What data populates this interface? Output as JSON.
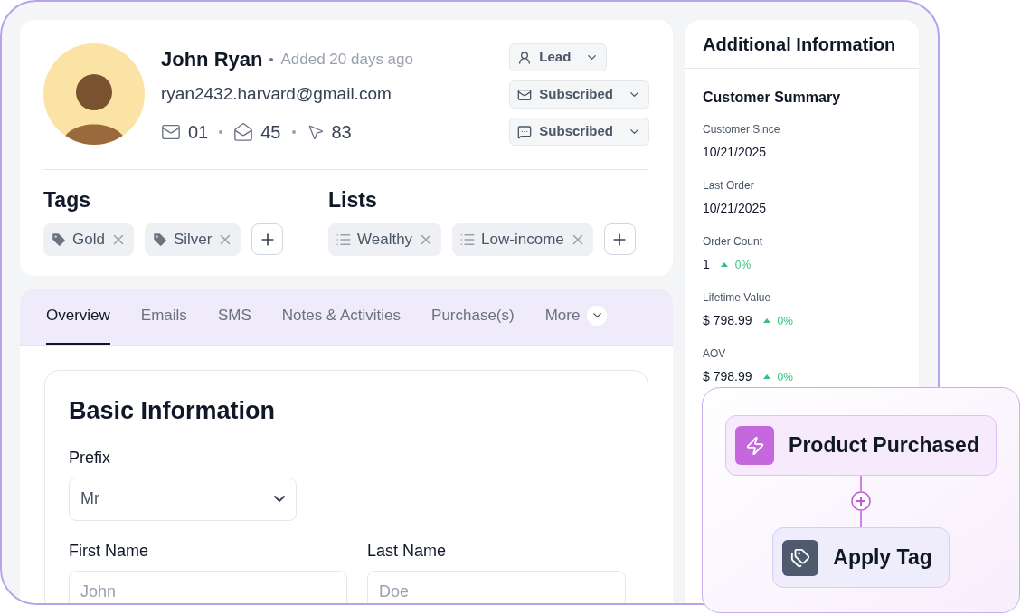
{
  "profile": {
    "name": "John Ryan",
    "added": "Added 20 days ago",
    "email": "ryan2432.harvard@gmail.com",
    "stats": [
      {
        "kind": "sent",
        "value": "01"
      },
      {
        "kind": "opened",
        "value": "45"
      },
      {
        "kind": "clicked",
        "value": "83"
      }
    ],
    "statuses": [
      {
        "kind": "contact",
        "label": "Lead"
      },
      {
        "kind": "email",
        "label": "Subscribed"
      },
      {
        "kind": "sms",
        "label": "Subscribed"
      }
    ]
  },
  "tags": {
    "title": "Tags",
    "items": [
      "Gold",
      "Silver"
    ]
  },
  "lists": {
    "title": "Lists",
    "items": [
      "Wealthy",
      "Low-income"
    ]
  },
  "tabs": [
    {
      "label": "Overview",
      "selected": true,
      "kind": "tab"
    },
    {
      "label": "Emails",
      "selected": false,
      "kind": "tab"
    },
    {
      "label": "SMS",
      "selected": false,
      "kind": "tab"
    },
    {
      "label": "Notes & Activities",
      "selected": false,
      "kind": "tab"
    },
    {
      "label": "Purchase(s)",
      "selected": false,
      "kind": "tab"
    },
    {
      "label": "More",
      "selected": false,
      "kind": "menu"
    }
  ],
  "basic_info": {
    "title": "Basic Information",
    "fields": [
      {
        "kind": "select",
        "label": "Prefix",
        "value": "Mr"
      },
      {
        "kind": "text",
        "label": "First Name",
        "placeholder": "John"
      },
      {
        "kind": "text",
        "label": "Last Name",
        "placeholder": "Doe"
      }
    ]
  },
  "additional_info": {
    "title": "Additional Information",
    "summary_title": "Customer Summary",
    "metrics": [
      {
        "label": "Customer Since",
        "value": "10/21/2025"
      },
      {
        "label": "Last Order",
        "value": "10/21/2025"
      },
      {
        "label": "Order Count",
        "value": "1",
        "change": "0%",
        "rising": true
      },
      {
        "label": "Lifetime Value",
        "value": "$ 798.99",
        "change": "0%",
        "rising": true
      },
      {
        "label": "AOV",
        "value": "$ 798.99",
        "change": "0%",
        "rising": true
      }
    ]
  },
  "workflow": {
    "nodes": [
      {
        "kind": "trigger",
        "label": "Product Purchased"
      },
      {
        "kind": "action",
        "label": "Apply Tag"
      }
    ]
  }
}
